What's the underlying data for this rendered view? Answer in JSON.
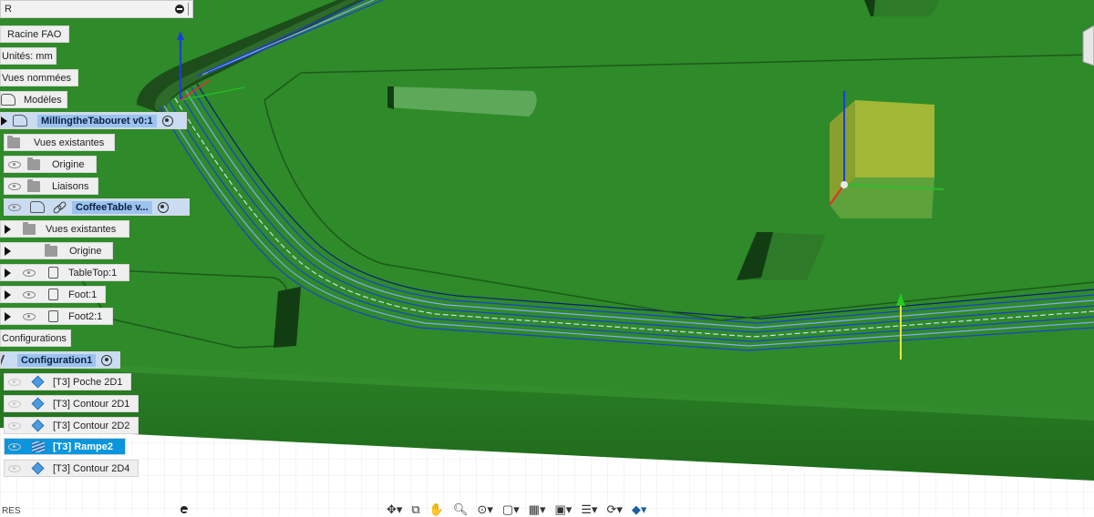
{
  "browser": {
    "header_title": "R",
    "nodes": {
      "root": "Racine FAO",
      "units": "Unités: mm",
      "named_views": "Vues nommées",
      "models": "Modèles",
      "design": "MillingtheTabouret v0:1",
      "existing_views": "Vues existantes",
      "origin": "Origine",
      "joints": "Liaisons",
      "coffee_table": "CoffeeTable v...",
      "existing_views_2": "Vues existantes",
      "origin_2": "Origine",
      "tabletop": "TableTop:1",
      "foot1": "Foot:1",
      "foot2": "Foot2:1",
      "configurations": "Configurations",
      "config1": "Configuration1"
    },
    "operations": [
      {
        "label": "[T3] Poche 2D1"
      },
      {
        "label": "[T3] Contour 2D1"
      },
      {
        "label": "[T3] Contour 2D2"
      },
      {
        "label": "[T3] Rampe2"
      },
      {
        "label": "[T3] Contour 2D4"
      }
    ],
    "bottom_label": "RES"
  },
  "colors": {
    "stock_green": "#2f8a2a",
    "toolpath_blue": "#1b3fd6",
    "selection_blue": "#0a96dc"
  },
  "toolbar": [
    "orbit-icon",
    "pan-icon",
    "zoom-icon",
    "fit-icon",
    "display-icon",
    "grid-icon",
    "viewports-icon",
    "layers-icon",
    "sync-icon",
    "cube-icon"
  ]
}
